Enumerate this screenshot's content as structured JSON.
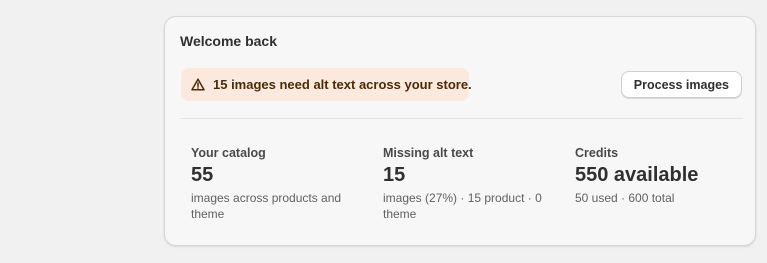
{
  "card": {
    "title": "Welcome back",
    "alert": {
      "icon": "warning-triangle-icon",
      "text": "15 images need alt text across your store."
    },
    "process_button_label": "Process images"
  },
  "stats": [
    {
      "label": "Your catalog",
      "value": "55",
      "description": "images across products and theme"
    },
    {
      "label": "Missing alt text",
      "value": "15",
      "description": "images (27%) · 15 product · 0 theme"
    },
    {
      "label": "Credits",
      "value": "550 available",
      "description": "50 used · 600 total"
    }
  ],
  "colors": {
    "background": "#f1f1f1",
    "card": "#f7f7f7",
    "alert_background": "#fbe9dd"
  }
}
